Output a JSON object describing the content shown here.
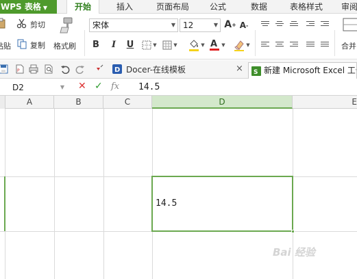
{
  "menubar": {
    "app_name": "WPS 表格",
    "tabs": [
      {
        "label": "开始",
        "active": true
      },
      {
        "label": "插入"
      },
      {
        "label": "页面布局"
      },
      {
        "label": "公式"
      },
      {
        "label": "数据"
      },
      {
        "label": "表格样式"
      },
      {
        "label": "审阅"
      }
    ]
  },
  "ribbon": {
    "paste_label": "粘贴",
    "cut_label": "剪切",
    "copy_label": "复制",
    "format_painter_label": "格式刷",
    "font_name": "宋体",
    "font_size": "12",
    "bold_label": "B",
    "italic_label": "I",
    "underline_label": "U",
    "merge_label": "合并"
  },
  "quick_access": {
    "doc_tabs": [
      {
        "label": "Docer-在线模板",
        "active": false
      },
      {
        "label": "新建 Microsoft Excel 工作表",
        "active": true
      }
    ],
    "close_glyph": "×"
  },
  "formula_bar": {
    "name_box": "D2",
    "cancel_glyph": "✕",
    "confirm_glyph": "✓",
    "fx_label": "fx",
    "value": "14.5"
  },
  "grid": {
    "columns": [
      "A",
      "B",
      "C",
      "D",
      "E"
    ],
    "selected_column": "D",
    "selected_cell": {
      "ref": "D2",
      "value": "14.5"
    }
  },
  "colors": {
    "accent_green": "#6aa84f",
    "brand_green": "#4e9a2c",
    "cancel_red": "#d33333",
    "confirm_green": "#2b9a2b"
  },
  "watermark": "Bai 经验"
}
